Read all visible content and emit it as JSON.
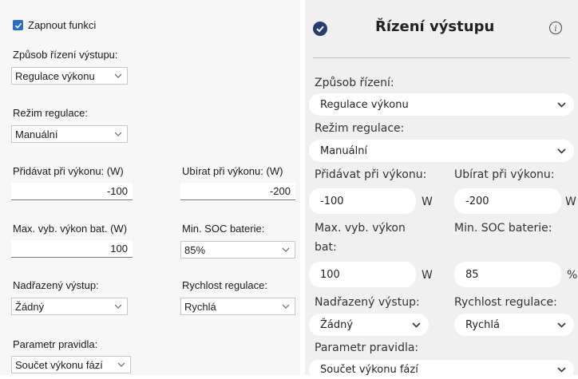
{
  "left_panel": {
    "enable_label": "Zapnout funkci",
    "enabled": true,
    "control_method_label": "Způsob řízení výstupu:",
    "control_method_value": "Regulace výkonu",
    "regulation_mode_label": "Režim regulace:",
    "regulation_mode_value": "Manuální",
    "add_at_power_label": "Přidávat při výkonu: (W)",
    "add_at_power_value": "-100",
    "remove_at_power_label": "Ubírat při výkonu: (W)",
    "remove_at_power_value": "-200",
    "max_discharge_label": "Max. vyb. výkon bat. (W)",
    "max_discharge_value": "100",
    "min_soc_label": "Min. SOC baterie:",
    "min_soc_value": "85%",
    "parent_output_label": "Nadřazený výstup:",
    "parent_output_value": "Žádný",
    "regulation_speed_label": "Rychlost regulace:",
    "regulation_speed_value": "Rychlá",
    "rule_param_label": "Parametr pravidla:",
    "rule_param_value": "Součet výkonu fází"
  },
  "right_panel": {
    "title": "Řízení výstupu",
    "control_method_label": "Způsob řízení:",
    "control_method_value": "Regulace výkonu",
    "regulation_mode_label": "Režim regulace:",
    "regulation_mode_value": "Manuální",
    "add_at_power_label": "Přidávat při výkonu:",
    "add_at_power_value": "-100",
    "add_at_power_unit": "W",
    "remove_at_power_label": "Ubírat při výkonu:",
    "remove_at_power_value": "-200",
    "remove_at_power_unit": "W",
    "max_discharge_label_line1": "Max. vyb. výkon",
    "max_discharge_label_line2": "bat:",
    "max_discharge_value": "100",
    "max_discharge_unit": "W",
    "min_soc_label": "Min. SOC baterie:",
    "min_soc_value": "85",
    "min_soc_unit": "%",
    "parent_output_label": "Nadřazený výstup:",
    "parent_output_value": "Žádný",
    "regulation_speed_label": "Rychlost regulace:",
    "regulation_speed_value": "Rychlá",
    "rule_param_label": "Parametr pravidla:",
    "rule_param_value": "Součet výkonu fází"
  },
  "colors": {
    "accent": "#2b6cc4",
    "header_icon": "#263c6a",
    "left_bg": "#f7f7f7",
    "right_bg": "#f0f0f0"
  },
  "icons": {
    "checkbox": "checkmark",
    "header": "check-circle-icon",
    "info": "info-icon",
    "dropdown": "chevron-down-icon"
  }
}
